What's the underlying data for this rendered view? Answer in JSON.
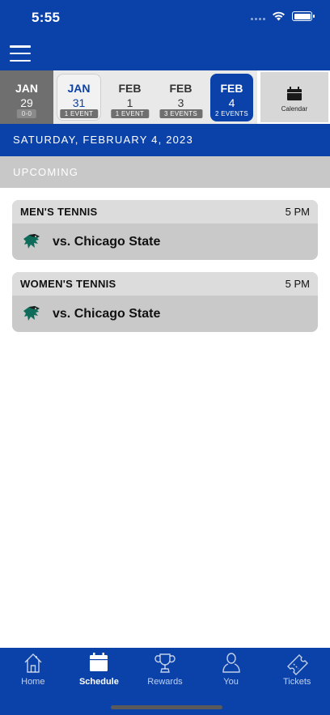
{
  "status_bar": {
    "time": "5:55"
  },
  "date_strip": {
    "items": [
      {
        "month": "JAN",
        "day": "29",
        "badge": "0-0",
        "state": "past"
      },
      {
        "month": "JAN",
        "day": "31",
        "badge": "1 EVENT",
        "state": "today"
      },
      {
        "month": "FEB",
        "day": "1",
        "badge": "1 EVENT",
        "state": "normal"
      },
      {
        "month": "FEB",
        "day": "3",
        "badge": "3 EVENTS",
        "state": "normal"
      },
      {
        "month": "FEB",
        "day": "4",
        "badge": "2 EVENTS",
        "state": "selected"
      }
    ],
    "calendar_label": "Calendar"
  },
  "selected_date": "SATURDAY, FEBRUARY 4, 2023",
  "section": {
    "title": "UPCOMING"
  },
  "events": [
    {
      "sport": "MEN'S TENNIS",
      "time": "5 PM",
      "opponent": "vs. Chicago State"
    },
    {
      "sport": "WOMEN'S TENNIS",
      "time": "5 PM",
      "opponent": "vs. Chicago State"
    }
  ],
  "tabs": [
    {
      "label": "Home",
      "icon": "home-icon"
    },
    {
      "label": "Schedule",
      "icon": "calendar-icon",
      "active": true
    },
    {
      "label": "Rewards",
      "icon": "trophy-icon"
    },
    {
      "label": "You",
      "icon": "person-icon"
    },
    {
      "label": "Tickets",
      "icon": "ticket-icon"
    }
  ],
  "colors": {
    "primary": "#0b42a9",
    "past_tile": "#6f6f6f",
    "section_bg": "#c8c8c8",
    "card_bg": "#c9c9c9"
  }
}
